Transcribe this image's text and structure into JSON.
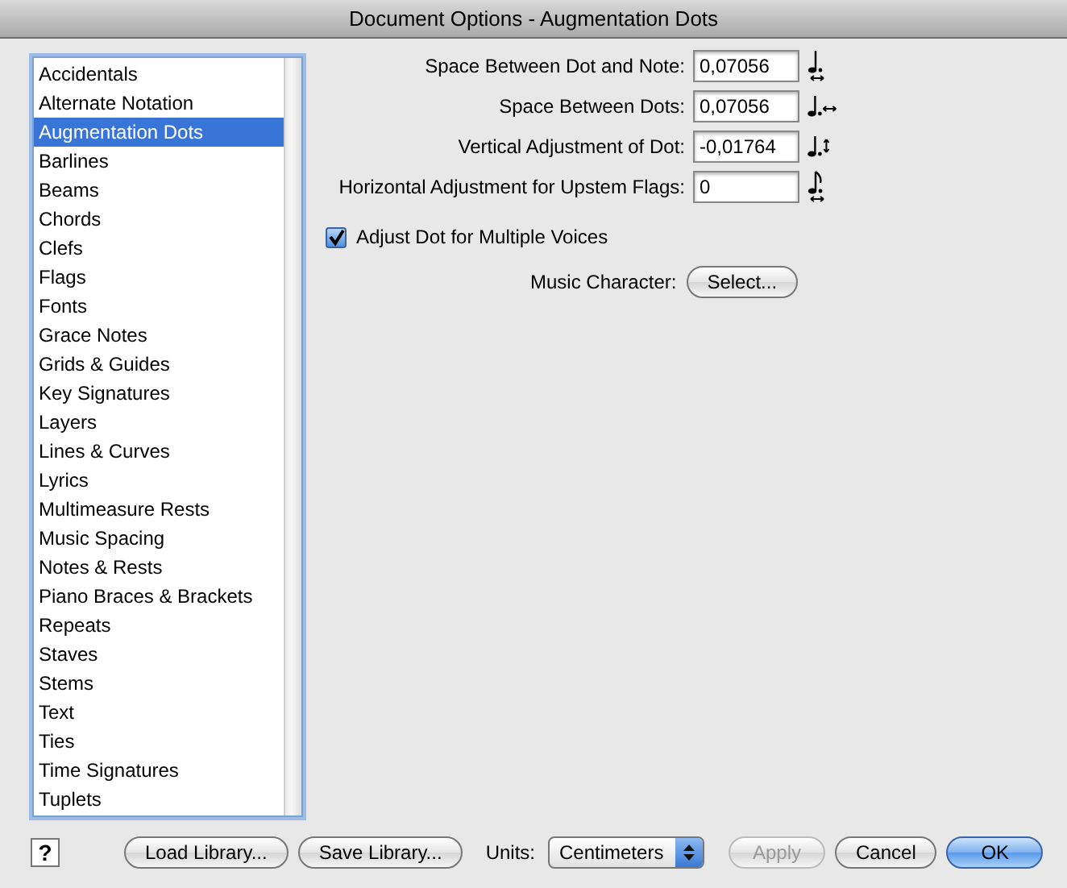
{
  "window": {
    "title": "Document Options - Augmentation Dots"
  },
  "categories": [
    {
      "label": "Accidentals",
      "selected": false
    },
    {
      "label": "Alternate Notation",
      "selected": false
    },
    {
      "label": "Augmentation Dots",
      "selected": true
    },
    {
      "label": "Barlines",
      "selected": false
    },
    {
      "label": "Beams",
      "selected": false
    },
    {
      "label": "Chords",
      "selected": false
    },
    {
      "label": "Clefs",
      "selected": false
    },
    {
      "label": "Flags",
      "selected": false
    },
    {
      "label": "Fonts",
      "selected": false
    },
    {
      "label": "Grace Notes",
      "selected": false
    },
    {
      "label": "Grids & Guides",
      "selected": false
    },
    {
      "label": "Key Signatures",
      "selected": false
    },
    {
      "label": "Layers",
      "selected": false
    },
    {
      "label": "Lines & Curves",
      "selected": false
    },
    {
      "label": "Lyrics",
      "selected": false
    },
    {
      "label": "Multimeasure Rests",
      "selected": false
    },
    {
      "label": "Music Spacing",
      "selected": false
    },
    {
      "label": "Notes & Rests",
      "selected": false
    },
    {
      "label": "Piano Braces & Brackets",
      "selected": false
    },
    {
      "label": "Repeats",
      "selected": false
    },
    {
      "label": "Staves",
      "selected": false
    },
    {
      "label": "Stems",
      "selected": false
    },
    {
      "label": "Text",
      "selected": false
    },
    {
      "label": "Ties",
      "selected": false
    },
    {
      "label": "Time Signatures",
      "selected": false
    },
    {
      "label": "Tuplets",
      "selected": false
    }
  ],
  "fields": [
    {
      "label": "Space Between Dot and Note:",
      "value": "0,07056"
    },
    {
      "label": "Space Between Dots:",
      "value": "0,07056"
    },
    {
      "label": "Vertical Adjustment of Dot:",
      "value": "-0,01764"
    },
    {
      "label": "Horizontal Adjustment for Upstem Flags:",
      "value": "0"
    }
  ],
  "checkbox": {
    "label": "Adjust Dot for Multiple Voices",
    "checked": true
  },
  "music_character": {
    "label": "Music Character:",
    "button": "Select..."
  },
  "footer": {
    "help": "?",
    "library_buttons": [
      "Load Library...",
      "Save Library..."
    ],
    "units_label": "Units:",
    "units_value": "Centimeters",
    "buttons": [
      {
        "label": "Apply",
        "disabled": true,
        "default": false
      },
      {
        "label": "Cancel",
        "disabled": false,
        "default": false
      },
      {
        "label": "OK",
        "disabled": false,
        "default": true
      }
    ]
  }
}
